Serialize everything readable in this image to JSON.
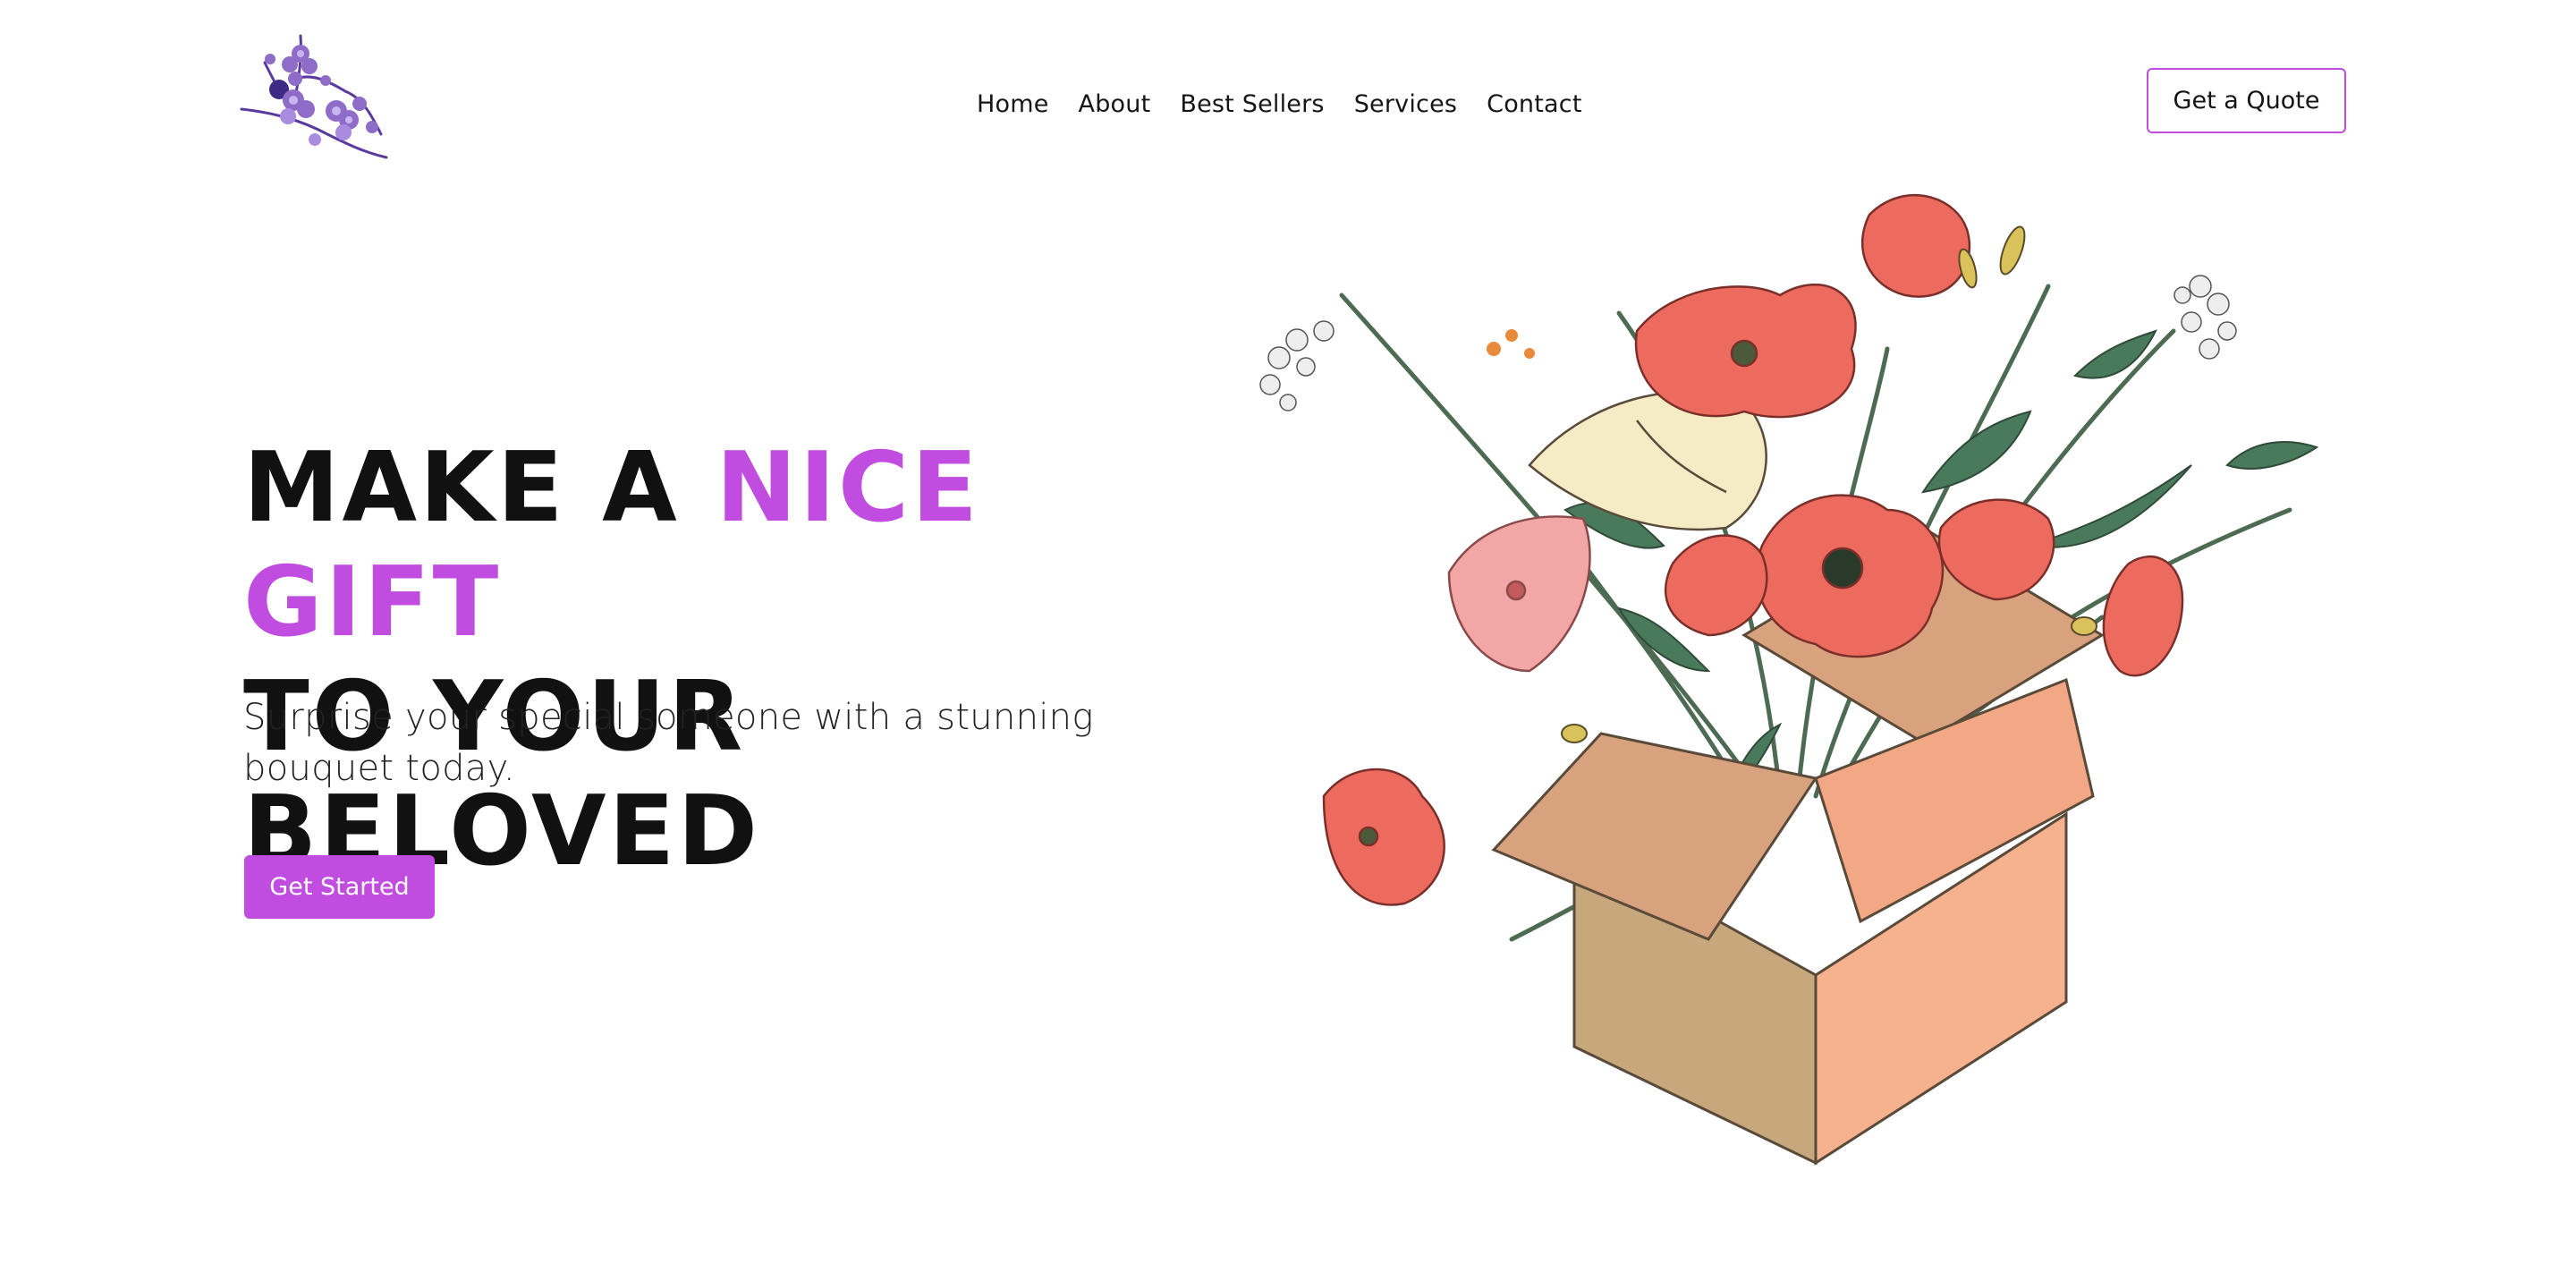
{
  "header": {
    "logo_icon": "lilac-flower-sprig-icon",
    "nav": [
      {
        "label": "Home"
      },
      {
        "label": "About"
      },
      {
        "label": "Best Sellers"
      },
      {
        "label": "Services"
      },
      {
        "label": "Contact"
      }
    ],
    "quote_button": "Get a Quote"
  },
  "hero": {
    "title_part1": "MAKE A ",
    "title_accent": "NICE GIFT",
    "title_line2": "TO YOUR BELOVED",
    "subtitle": "Surprise your special someone with a stunning bouquet today.",
    "cta_button": "Get Started",
    "illustration": "flower-bouquet-in-box-illustration"
  },
  "colors": {
    "accent": "#c04de0",
    "text": "#141414",
    "box_light": "#f6b28f",
    "box_dark": "#c7a77c",
    "poppy": "#ec6b5e"
  }
}
